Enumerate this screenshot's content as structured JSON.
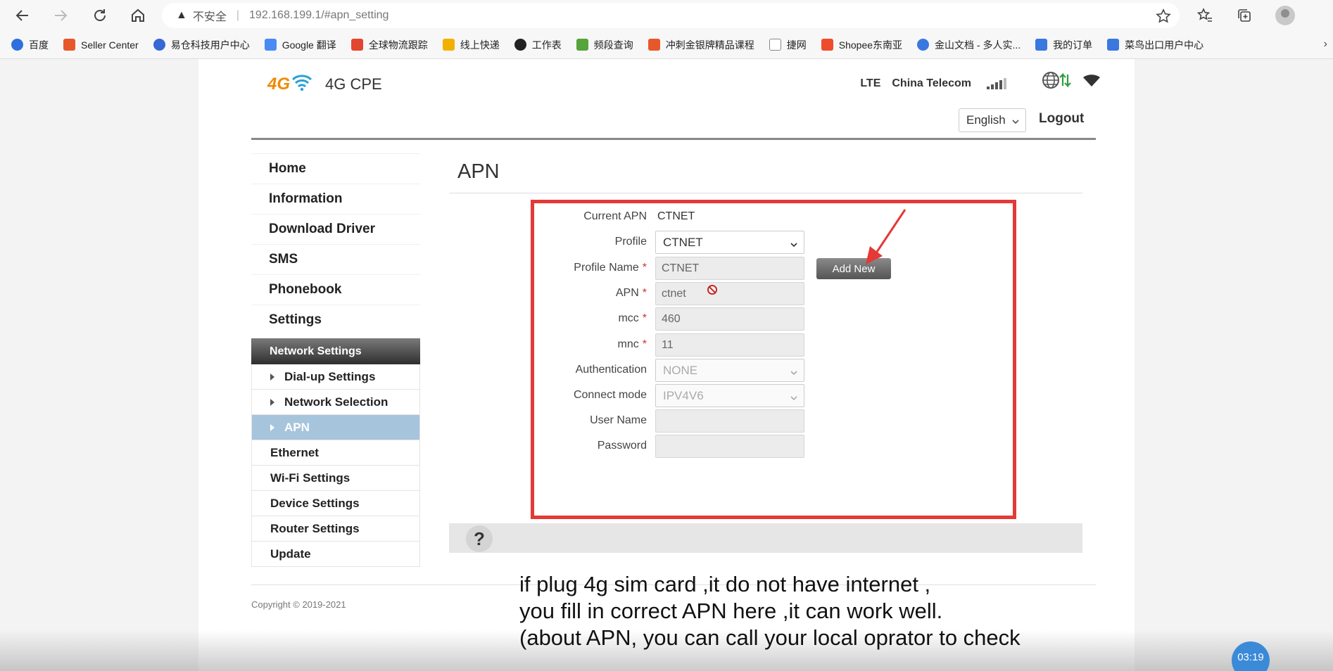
{
  "browser": {
    "security_label": "不安全",
    "url": "192.168.199.1/#apn_setting",
    "bookmarks": [
      {
        "label": "百度",
        "color": "#2f6fde"
      },
      {
        "label": "Seller Center",
        "color": "#e8572a"
      },
      {
        "label": "易仓科技用户中心",
        "color": "#3567d6"
      },
      {
        "label": "Google 翻译",
        "color": "#4a8af4"
      },
      {
        "label": "全球物流跟踪",
        "color": "#e2462f"
      },
      {
        "label": "线上快递",
        "color": "#f2b100"
      },
      {
        "label": "工作表",
        "color": "#222222"
      },
      {
        "label": "频段查询",
        "color": "#56a53a"
      },
      {
        "label": "冲刺金银牌精品课程",
        "color": "#e8572a"
      },
      {
        "label": "捷网",
        "color": "#888888"
      },
      {
        "label": "Shopee东南亚",
        "color": "#ee4d2d"
      },
      {
        "label": "金山文档 - 多人实...",
        "color": "#3a78e0"
      },
      {
        "label": "我的订单",
        "color": "#3a78e0"
      },
      {
        "label": "菜鸟出口用户中心",
        "color": "#3a78e0"
      }
    ]
  },
  "header": {
    "brand_4g": "4G",
    "product": "4G CPE",
    "network_type": "LTE",
    "operator": "China Telecom",
    "language": "English",
    "logout": "Logout"
  },
  "sidebar": {
    "top_items": [
      "Home",
      "Information",
      "Download Driver",
      "SMS",
      "Phonebook",
      "Settings"
    ],
    "section": "Network Settings",
    "sub_items": [
      "Dial-up Settings",
      "Network Selection",
      "APN"
    ],
    "other_items": [
      "Ethernet",
      "Wi-Fi Settings",
      "Device Settings",
      "Router Settings",
      "Update"
    ]
  },
  "main": {
    "title": "APN",
    "current_apn_label": "Current APN",
    "current_apn_value": "CTNET",
    "profile_label": "Profile",
    "profile_value": "CTNET",
    "profile_name_label": "Profile Name",
    "profile_name_value": "CTNET",
    "add_new": "Add New",
    "apn_label": "APN",
    "apn_value": "ctnet",
    "mcc_label": "mcc",
    "mcc_value": "460",
    "mnc_label": "mnc",
    "mnc_value": "11",
    "auth_label": "Authentication",
    "auth_value": "NONE",
    "connect_label": "Connect mode",
    "connect_value": "IPV4V6",
    "username_label": "User Name",
    "username_value": "",
    "password_label": "Password",
    "password_value": "",
    "required_mark": "*",
    "help": "?"
  },
  "footer": {
    "copyright": "Copyright © 2019-2021"
  },
  "overlay": {
    "subtitle_line1": "if plug 4g sim card ,it do not have internet ,",
    "subtitle_line2": "you fill in correct APN here ,it can work well.",
    "subtitle_line3": "(about APN, you can call your local oprator to check",
    "timer": "03:19"
  },
  "colors": {
    "highlight_box": "#e53935",
    "active_menu": "#a7c4dd",
    "brand_orange": "#f08a00",
    "wifi_blue": "#2a9fd8"
  }
}
